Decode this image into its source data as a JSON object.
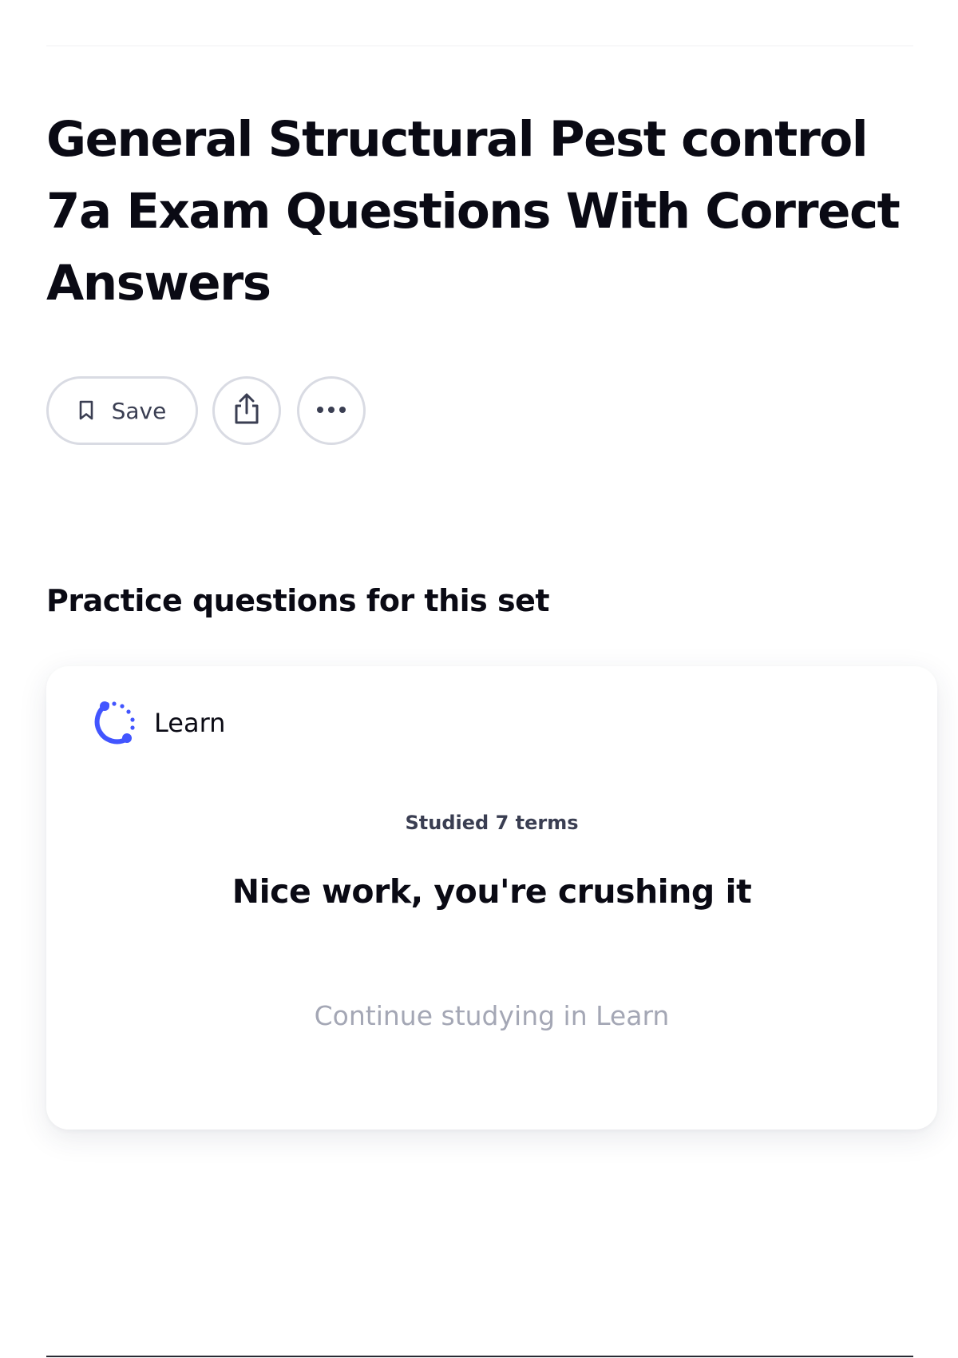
{
  "header": {
    "title": "General Structural Pest control 7a Exam Questions With Correct Answers"
  },
  "actions": {
    "save_label": "Save",
    "save_icon": "bookmark-icon",
    "share_icon": "share-icon",
    "more_icon": "more-horizontal-icon"
  },
  "practice": {
    "heading": "Practice questions for this set",
    "learn": {
      "label": "Learn",
      "icon": "learn-progress-icon",
      "accent_color": "#4255ff",
      "studied_text": "Studied 7 terms",
      "message": "Nice work, you're crushing it",
      "continue_label": "Continue studying in Learn"
    }
  }
}
